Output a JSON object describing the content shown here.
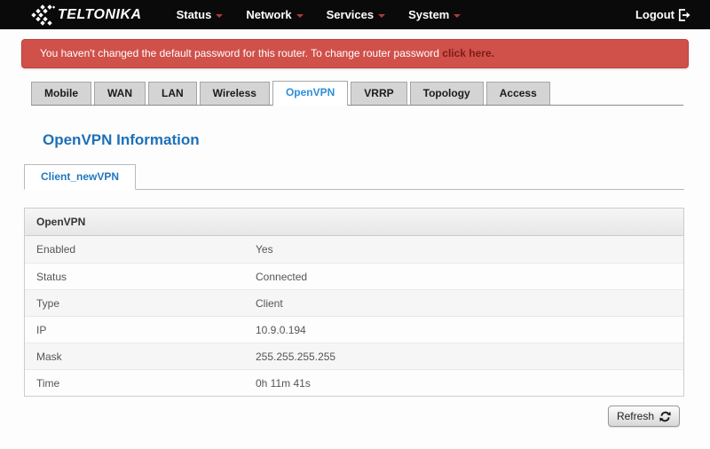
{
  "navbar": {
    "brand": "TELTONIKA",
    "menus": [
      {
        "label": "Status"
      },
      {
        "label": "Network"
      },
      {
        "label": "Services"
      },
      {
        "label": "System"
      }
    ],
    "logout_label": "Logout"
  },
  "banner": {
    "text": "You haven't changed the default password for this router. To change router password",
    "link_text": "click here."
  },
  "tabs": [
    "Mobile",
    "WAN",
    "LAN",
    "Wireless",
    "OpenVPN",
    "VRRP",
    "Topology",
    "Access"
  ],
  "active_tab": "OpenVPN",
  "page_title": "OpenVPN Information",
  "subtab": "Client_newVPN",
  "table": {
    "header": "OpenVPN",
    "rows": [
      {
        "label": "Enabled",
        "value": "Yes"
      },
      {
        "label": "Status",
        "value": "Connected"
      },
      {
        "label": "Type",
        "value": "Client"
      },
      {
        "label": "IP",
        "value": "10.9.0.194"
      },
      {
        "label": "Mask",
        "value": "255.255.255.255"
      },
      {
        "label": "Time",
        "value": "0h 11m 41s"
      }
    ]
  },
  "refresh_button": {
    "label": "Refresh"
  },
  "colors": {
    "navbar_bg": "#0a0a0a",
    "banner_bg": "#d0504a",
    "banner_link": "#7e1d1a",
    "accent_blue": "#2e8ed6",
    "heading_blue": "#1d70b7",
    "caret_red": "#a83d3d"
  }
}
